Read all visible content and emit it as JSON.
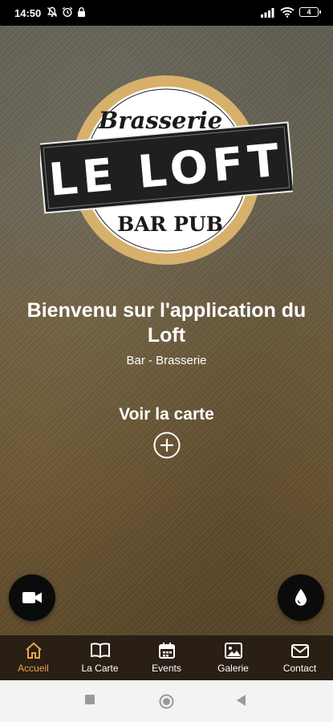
{
  "status_bar": {
    "time": "14:50",
    "battery": "4"
  },
  "logo": {
    "top_text": "Brasserie",
    "main_text": "LE LOFT",
    "bottom_text": "BAR PUB"
  },
  "welcome": {
    "title": "Bienvenu sur l'application du Loft",
    "subtitle": "Bar - Brasserie"
  },
  "menu_link": {
    "label": "Voir la carte"
  },
  "fabs": {
    "left_icon": "video-camera-icon",
    "right_icon": "water-drop-icon"
  },
  "bottom_nav": {
    "items": [
      {
        "label": "Accueil",
        "icon": "home-icon",
        "active": true
      },
      {
        "label": "La Carte",
        "icon": "book-icon",
        "active": false
      },
      {
        "label": "Events",
        "icon": "calendar-icon",
        "active": false
      },
      {
        "label": "Galerie",
        "icon": "image-icon",
        "active": false
      },
      {
        "label": "Contact",
        "icon": "mail-icon",
        "active": false
      }
    ]
  },
  "colors": {
    "accent": "#e6a64a",
    "nav_bg": "#2a1f14",
    "logo_ring": "#d7b06b"
  }
}
